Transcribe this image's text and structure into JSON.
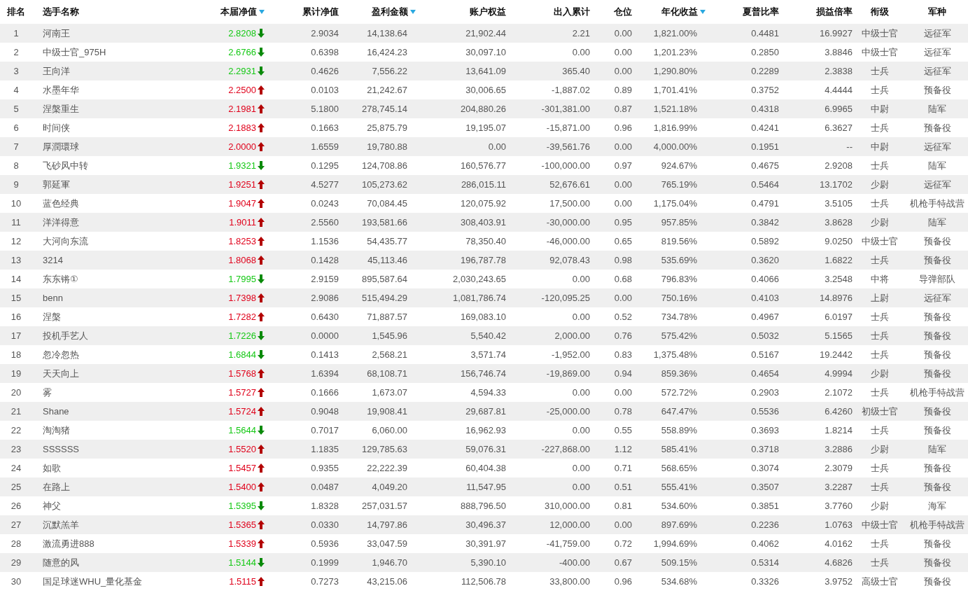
{
  "table": {
    "columns": [
      {
        "label": "排名",
        "sortable": false
      },
      {
        "label": "选手名称",
        "sortable": false
      },
      {
        "label": "本届净值",
        "sortable": true
      },
      {
        "label": "累计净值",
        "sortable": false
      },
      {
        "label": "盈利金额",
        "sortable": true
      },
      {
        "label": "账户权益",
        "sortable": false
      },
      {
        "label": "出入累计",
        "sortable": false
      },
      {
        "label": "仓位",
        "sortable": false
      },
      {
        "label": "年化收益",
        "sortable": true
      },
      {
        "label": "夏普比率",
        "sortable": false
      },
      {
        "label": "损益倍率",
        "sortable": false
      },
      {
        "label": "衔级",
        "sortable": false
      },
      {
        "label": "军种",
        "sortable": false
      }
    ],
    "rows": [
      {
        "kind": "down",
        "cells": [
          "1",
          "河南王",
          "2.8208",
          "2.9034",
          "14,138.64",
          "21,902.44",
          "2.21",
          "0.00",
          "1,821.00%",
          "0.4481",
          "16.9927",
          "中级士官",
          "远征军"
        ]
      },
      {
        "kind": "down",
        "cells": [
          "2",
          "中级士官_975H",
          "2.6766",
          "0.6398",
          "16,424.23",
          "30,097.10",
          "0.00",
          "0.00",
          "1,201.23%",
          "0.2850",
          "3.8846",
          "中级士官",
          "远征军"
        ]
      },
      {
        "kind": "down",
        "cells": [
          "3",
          "王向洋",
          "2.2931",
          "0.4626",
          "7,556.22",
          "13,641.09",
          "365.40",
          "0.00",
          "1,290.80%",
          "0.2289",
          "2.3838",
          "士兵",
          "远征军"
        ]
      },
      {
        "kind": "up",
        "cells": [
          "4",
          "水墨年华",
          "2.2500",
          "0.0103",
          "21,242.67",
          "30,006.65",
          "-1,887.02",
          "0.89",
          "1,701.41%",
          "0.3752",
          "4.4444",
          "士兵",
          "预备役"
        ]
      },
      {
        "kind": "up",
        "cells": [
          "5",
          "涅槃重生",
          "2.1981",
          "5.1800",
          "278,745.14",
          "204,880.26",
          "-301,381.00",
          "0.87",
          "1,521.18%",
          "0.4318",
          "6.9965",
          "中尉",
          "陆军"
        ]
      },
      {
        "kind": "up",
        "cells": [
          "6",
          "时间侠",
          "2.1883",
          "0.1663",
          "25,875.79",
          "19,195.07",
          "-15,871.00",
          "0.96",
          "1,816.99%",
          "0.4241",
          "6.3627",
          "士兵",
          "预备役"
        ]
      },
      {
        "kind": "up",
        "cells": [
          "7",
          "厚潤環球",
          "2.0000",
          "1.6559",
          "19,780.88",
          "0.00",
          "-39,561.76",
          "0.00",
          "4,000.00%",
          "0.1951",
          "--",
          "中尉",
          "远征军"
        ]
      },
      {
        "kind": "down",
        "cells": [
          "8",
          "飞砂风中转",
          "1.9321",
          "0.1295",
          "124,708.86",
          "160,576.77",
          "-100,000.00",
          "0.97",
          "924.67%",
          "0.4675",
          "2.9208",
          "士兵",
          "陆军"
        ]
      },
      {
        "kind": "up",
        "cells": [
          "9",
          "郭延軍",
          "1.9251",
          "4.5277",
          "105,273.62",
          "286,015.11",
          "52,676.61",
          "0.00",
          "765.19%",
          "0.5464",
          "13.1702",
          "少尉",
          "远征军"
        ]
      },
      {
        "kind": "up",
        "cells": [
          "10",
          "蓝色经典",
          "1.9047",
          "0.0243",
          "70,084.45",
          "120,075.92",
          "17,500.00",
          "0.00",
          "1,175.04%",
          "0.4791",
          "3.5105",
          "士兵",
          "机枪手特战营"
        ]
      },
      {
        "kind": "up",
        "cells": [
          "11",
          "洋洋得意",
          "1.9011",
          "2.5560",
          "193,581.66",
          "308,403.91",
          "-30,000.00",
          "0.95",
          "957.85%",
          "0.3842",
          "3.8628",
          "少尉",
          "陆军"
        ]
      },
      {
        "kind": "up",
        "cells": [
          "12",
          "大河向东流",
          "1.8253",
          "1.1536",
          "54,435.77",
          "78,350.40",
          "-46,000.00",
          "0.65",
          "819.56%",
          "0.5892",
          "9.0250",
          "中级士官",
          "预备役"
        ]
      },
      {
        "kind": "up",
        "cells": [
          "13",
          "3214",
          "1.8068",
          "0.1428",
          "45,113.46",
          "196,787.78",
          "92,078.43",
          "0.98",
          "535.69%",
          "0.3620",
          "1.6822",
          "士兵",
          "预备役"
        ]
      },
      {
        "kind": "down",
        "cells": [
          "14",
          "东东锵①",
          "1.7995",
          "2.9159",
          "895,587.64",
          "2,030,243.65",
          "0.00",
          "0.68",
          "796.83%",
          "0.4066",
          "3.2548",
          "中将",
          "导弹部队"
        ]
      },
      {
        "kind": "up",
        "cells": [
          "15",
          "benn",
          "1.7398",
          "2.9086",
          "515,494.29",
          "1,081,786.74",
          "-120,095.25",
          "0.00",
          "750.16%",
          "0.4103",
          "14.8976",
          "上尉",
          "远征军"
        ]
      },
      {
        "kind": "up",
        "cells": [
          "16",
          "涅槃",
          "1.7282",
          "0.6430",
          "71,887.57",
          "169,083.10",
          "0.00",
          "0.52",
          "734.78%",
          "0.4967",
          "6.0197",
          "士兵",
          "预备役"
        ]
      },
      {
        "kind": "down",
        "cells": [
          "17",
          "投机手艺人",
          "1.7226",
          "0.0000",
          "1,545.96",
          "5,540.42",
          "2,000.00",
          "0.76",
          "575.42%",
          "0.5032",
          "5.1565",
          "士兵",
          "预备役"
        ]
      },
      {
        "kind": "down",
        "cells": [
          "18",
          "忽冷忽热",
          "1.6844",
          "0.1413",
          "2,568.21",
          "3,571.74",
          "-1,952.00",
          "0.83",
          "1,375.48%",
          "0.5167",
          "19.2442",
          "士兵",
          "预备役"
        ]
      },
      {
        "kind": "up",
        "cells": [
          "19",
          "天天向上",
          "1.5768",
          "1.6394",
          "68,108.71",
          "156,746.74",
          "-19,869.00",
          "0.94",
          "859.36%",
          "0.4654",
          "4.9994",
          "少尉",
          "预备役"
        ]
      },
      {
        "kind": "up",
        "cells": [
          "20",
          "雾",
          "1.5727",
          "0.1666",
          "1,673.07",
          "4,594.33",
          "0.00",
          "0.00",
          "572.72%",
          "0.2903",
          "2.1072",
          "士兵",
          "机枪手特战营"
        ]
      },
      {
        "kind": "up",
        "cells": [
          "21",
          "Shane",
          "1.5724",
          "0.9048",
          "19,908.41",
          "29,687.81",
          "-25,000.00",
          "0.78",
          "647.47%",
          "0.5536",
          "6.4260",
          "初级士官",
          "预备役"
        ]
      },
      {
        "kind": "down",
        "cells": [
          "22",
          "淘淘猪",
          "1.5644",
          "0.7017",
          "6,060.00",
          "16,962.93",
          "0.00",
          "0.55",
          "558.89%",
          "0.3693",
          "1.8214",
          "士兵",
          "预备役"
        ]
      },
      {
        "kind": "up",
        "cells": [
          "23",
          "SSSSSS",
          "1.5520",
          "1.1835",
          "129,785.63",
          "59,076.31",
          "-227,868.00",
          "1.12",
          "585.41%",
          "0.3718",
          "3.2886",
          "少尉",
          "陆军"
        ]
      },
      {
        "kind": "up",
        "cells": [
          "24",
          "如歌",
          "1.5457",
          "0.9355",
          "22,222.39",
          "60,404.38",
          "0.00",
          "0.71",
          "568.65%",
          "0.3074",
          "2.3079",
          "士兵",
          "预备役"
        ]
      },
      {
        "kind": "up",
        "cells": [
          "25",
          "在路上",
          "1.5400",
          "0.0487",
          "4,049.20",
          "11,547.95",
          "0.00",
          "0.51",
          "555.41%",
          "0.3507",
          "3.2287",
          "士兵",
          "预备役"
        ]
      },
      {
        "kind": "down",
        "cells": [
          "26",
          "神父",
          "1.5395",
          "1.8328",
          "257,031.57",
          "888,796.50",
          "310,000.00",
          "0.81",
          "534.60%",
          "0.3851",
          "3.7760",
          "少尉",
          "海军"
        ]
      },
      {
        "kind": "up",
        "cells": [
          "27",
          "沉默羔羊",
          "1.5365",
          "0.0330",
          "14,797.86",
          "30,496.37",
          "12,000.00",
          "0.00",
          "897.69%",
          "0.2236",
          "1.0763",
          "中级士官",
          "机枪手特战营"
        ]
      },
      {
        "kind": "up",
        "cells": [
          "28",
          "激流勇进888",
          "1.5339",
          "0.5936",
          "33,047.59",
          "30,391.97",
          "-41,759.00",
          "0.72",
          "1,994.69%",
          "0.4062",
          "4.0162",
          "士兵",
          "预备役"
        ]
      },
      {
        "kind": "down",
        "cells": [
          "29",
          "随意的风",
          "1.5144",
          "0.1999",
          "1,946.70",
          "5,390.10",
          "-400.00",
          "0.67",
          "509.15%",
          "0.5314",
          "4.6826",
          "士兵",
          "预备役"
        ]
      },
      {
        "kind": "up",
        "cells": [
          "30",
          "国足球迷WHU_量化基金",
          "1.5115",
          "0.7273",
          "43,215.06",
          "112,506.78",
          "33,800.00",
          "0.96",
          "534.68%",
          "0.3326",
          "3.9752",
          "高级士官",
          "预备役"
        ]
      }
    ]
  }
}
